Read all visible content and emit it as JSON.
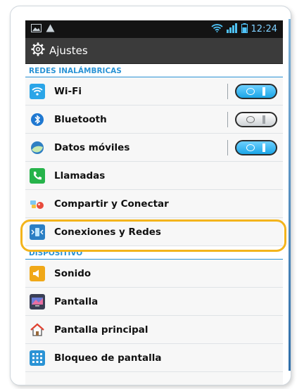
{
  "statusbar": {
    "time": "12:24"
  },
  "actionbar": {
    "title": "Ajustes"
  },
  "sections": {
    "wireless": {
      "header": "REDES INALÁMBRICAS",
      "items": [
        {
          "label": "Wi-Fi",
          "toggle": "on"
        },
        {
          "label": "Bluetooth",
          "toggle": "off"
        },
        {
          "label": "Datos móviles",
          "toggle": "on"
        },
        {
          "label": "Llamadas"
        },
        {
          "label": "Compartir y Conectar"
        },
        {
          "label": "Conexiones y Redes",
          "highlighted": true
        }
      ]
    },
    "device": {
      "header": "DISPOSITIVO",
      "items": [
        {
          "label": "Sonido"
        },
        {
          "label": "Pantalla"
        },
        {
          "label": "Pantalla principal"
        },
        {
          "label": "Bloqueo de pantalla"
        }
      ]
    }
  },
  "colors": {
    "accent": "#2a93d5",
    "highlight": "#f3b41c",
    "toggle_on": "#1ba6e7"
  }
}
